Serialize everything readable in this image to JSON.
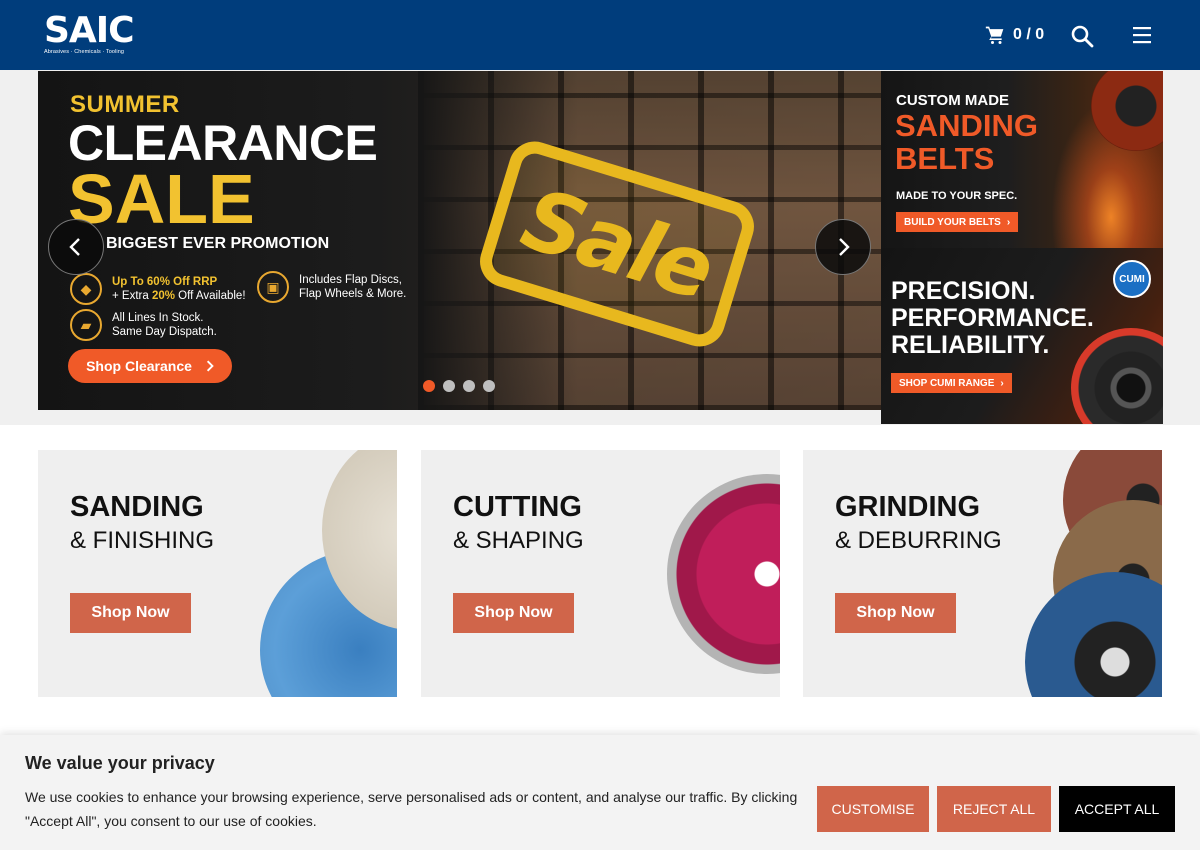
{
  "header": {
    "logo_text": "SAIC",
    "logo_tagline": "Abrasives · Chemicals · Tooling",
    "cart_label": "0 / 0",
    "brand_color": "#003d7c"
  },
  "hero": {
    "line1": "SUMMER",
    "line2": "CLEARANCE",
    "line3": "SALE",
    "line4": "BIGGEST EVER PROMOTION",
    "stamp": "Sale",
    "features": [
      {
        "icon": "tag-icon",
        "line1a": "Up To 60% Off RRP",
        "line2a": "+ Extra ",
        "highlight": "20%",
        "line2b": " Off Available!"
      },
      {
        "icon": "box-icon",
        "line1": "Includes Flap Discs,",
        "line2": "Flap Wheels & More."
      },
      {
        "icon": "truck-icon",
        "line1": "All Lines In Stock.",
        "line2": "Same Day Dispatch."
      }
    ],
    "cta": "Shop Clearance",
    "active_slide": 1,
    "slide_count": 4,
    "accent_color": "#f05a28"
  },
  "promos": [
    {
      "line1": "CUSTOM MADE",
      "line2": "SANDING",
      "line3": "BELTS",
      "line4": "MADE TO YOUR SPEC.",
      "button": "BUILD YOUR BELTS"
    },
    {
      "badge": "CUMI",
      "line1": "PRECISION.",
      "line2": "PERFORMANCE.",
      "line3": "RELIABILITY.",
      "button": "SHOP CUMI RANGE"
    }
  ],
  "categories": [
    {
      "title": "SANDING",
      "subtitle": "& FINISHING",
      "button": "Shop Now"
    },
    {
      "title": "CUTTING",
      "subtitle": "& SHAPING",
      "button": "Shop Now"
    },
    {
      "title": "GRINDING",
      "subtitle": "& DEBURRING",
      "button": "Shop Now"
    }
  ],
  "cookie": {
    "title": "We value your privacy",
    "text": "We use cookies to enhance your browsing experience, serve personalised ads or content, and analyse our traffic. By clicking \"Accept All\", you consent to our use of cookies.",
    "customise": "CUSTOMISE",
    "reject": "REJECT ALL",
    "accept": "ACCEPT ALL",
    "button_color": "#d0654a"
  }
}
